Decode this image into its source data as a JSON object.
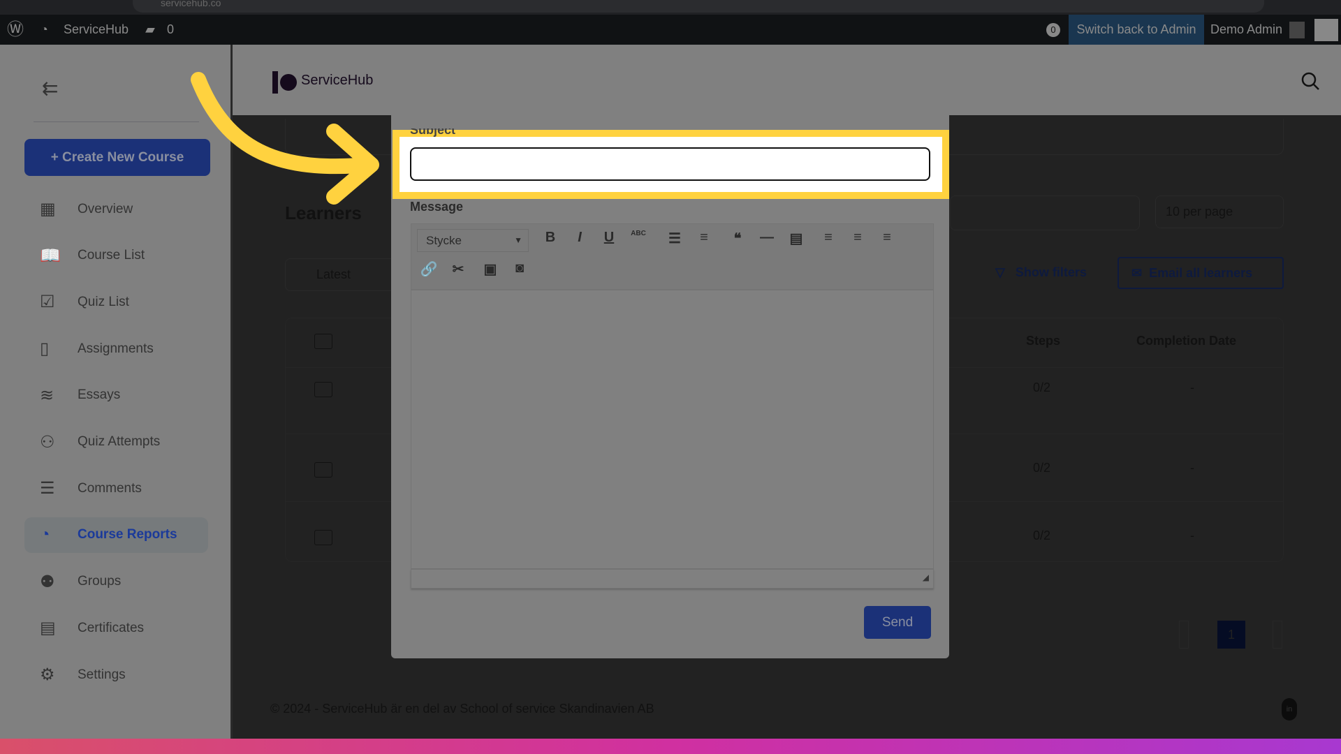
{
  "browser": {
    "url": "servicehub.co"
  },
  "wpbar": {
    "site": "ServiceHub",
    "comments": "0",
    "updates": "0",
    "switch": "Switch back to Admin",
    "user": "Demo Admin"
  },
  "sidebar": {
    "create": "+ Create New Course",
    "items": [
      {
        "label": "Overview",
        "icon": "overview-icon"
      },
      {
        "label": "Course List",
        "icon": "book-icon"
      },
      {
        "label": "Quiz List",
        "icon": "quiz-icon"
      },
      {
        "label": "Assignments",
        "icon": "file-icon"
      },
      {
        "label": "Essays",
        "icon": "layers-icon"
      },
      {
        "label": "Quiz Attempts",
        "icon": "user-question-icon"
      },
      {
        "label": "Comments",
        "icon": "comment-icon"
      },
      {
        "label": "Course Reports",
        "icon": "pie-chart-icon",
        "active": true
      },
      {
        "label": "Groups",
        "icon": "users-icon"
      },
      {
        "label": "Certificates",
        "icon": "certificate-icon"
      },
      {
        "label": "Settings",
        "icon": "gear-icon"
      }
    ]
  },
  "header": {
    "brand": "ServiceHub"
  },
  "page": {
    "title": "Learners",
    "sort": "Latest",
    "per_page": "10 per page",
    "show_filters": "Show filters",
    "email_all": "Email all learners",
    "columns": [
      "Steps",
      "Completion Date"
    ],
    "rows": [
      {
        "steps": "0/2",
        "date": "-"
      },
      {
        "steps": "0/2",
        "date": "-"
      },
      {
        "steps": "0/2",
        "date": "-"
      }
    ],
    "current_page": "1"
  },
  "footer": {
    "text": "© 2024 - ServiceHub är en del av School of service Skandinavien AB"
  },
  "modal": {
    "subject_label": "Subject",
    "subject_value": "",
    "message_label": "Message",
    "format": "Stycke",
    "send": "Send"
  },
  "colors": {
    "highlight": "#ffd23f",
    "accent": "#1b3178"
  }
}
